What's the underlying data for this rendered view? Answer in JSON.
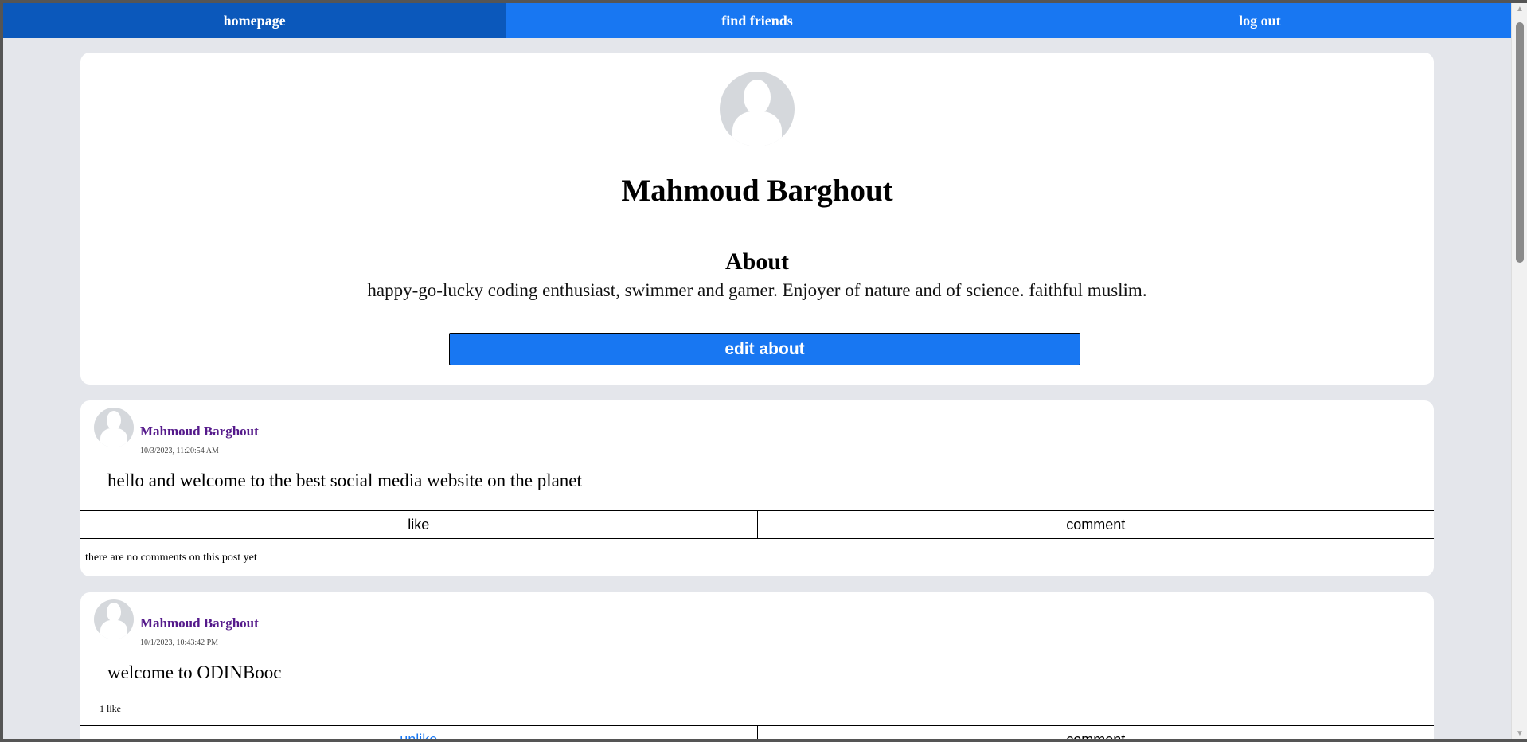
{
  "nav": {
    "items": [
      {
        "label": "homepage",
        "active": true
      },
      {
        "label": "find friends",
        "active": false
      },
      {
        "label": "log out",
        "active": false
      }
    ]
  },
  "profile": {
    "name": "Mahmoud Barghout",
    "about_heading": "About",
    "about_text": "happy-go-lucky coding enthusiast, swimmer and gamer. Enjoyer of nature and of science. faithful muslim.",
    "edit_button": "edit about"
  },
  "posts": [
    {
      "author": "Mahmoud Barghout",
      "timestamp": "10/3/2023, 11:20:54 AM",
      "text": "hello and welcome to the best social media website on the planet",
      "like_label": "like",
      "comment_label": "comment",
      "comments_text": "there are no comments on this post yet"
    },
    {
      "author": "Mahmoud Barghout",
      "timestamp": "10/1/2023, 10:43:42 PM",
      "text": "welcome to ODINBooc",
      "likes_count": "1 like",
      "like_label": "unlike",
      "comment_label": "comment"
    }
  ],
  "colors": {
    "brand": "#1877f2",
    "nav_active": "#0b58bb",
    "page_bg": "#e4e6eb",
    "author_link": "#551a8b"
  }
}
